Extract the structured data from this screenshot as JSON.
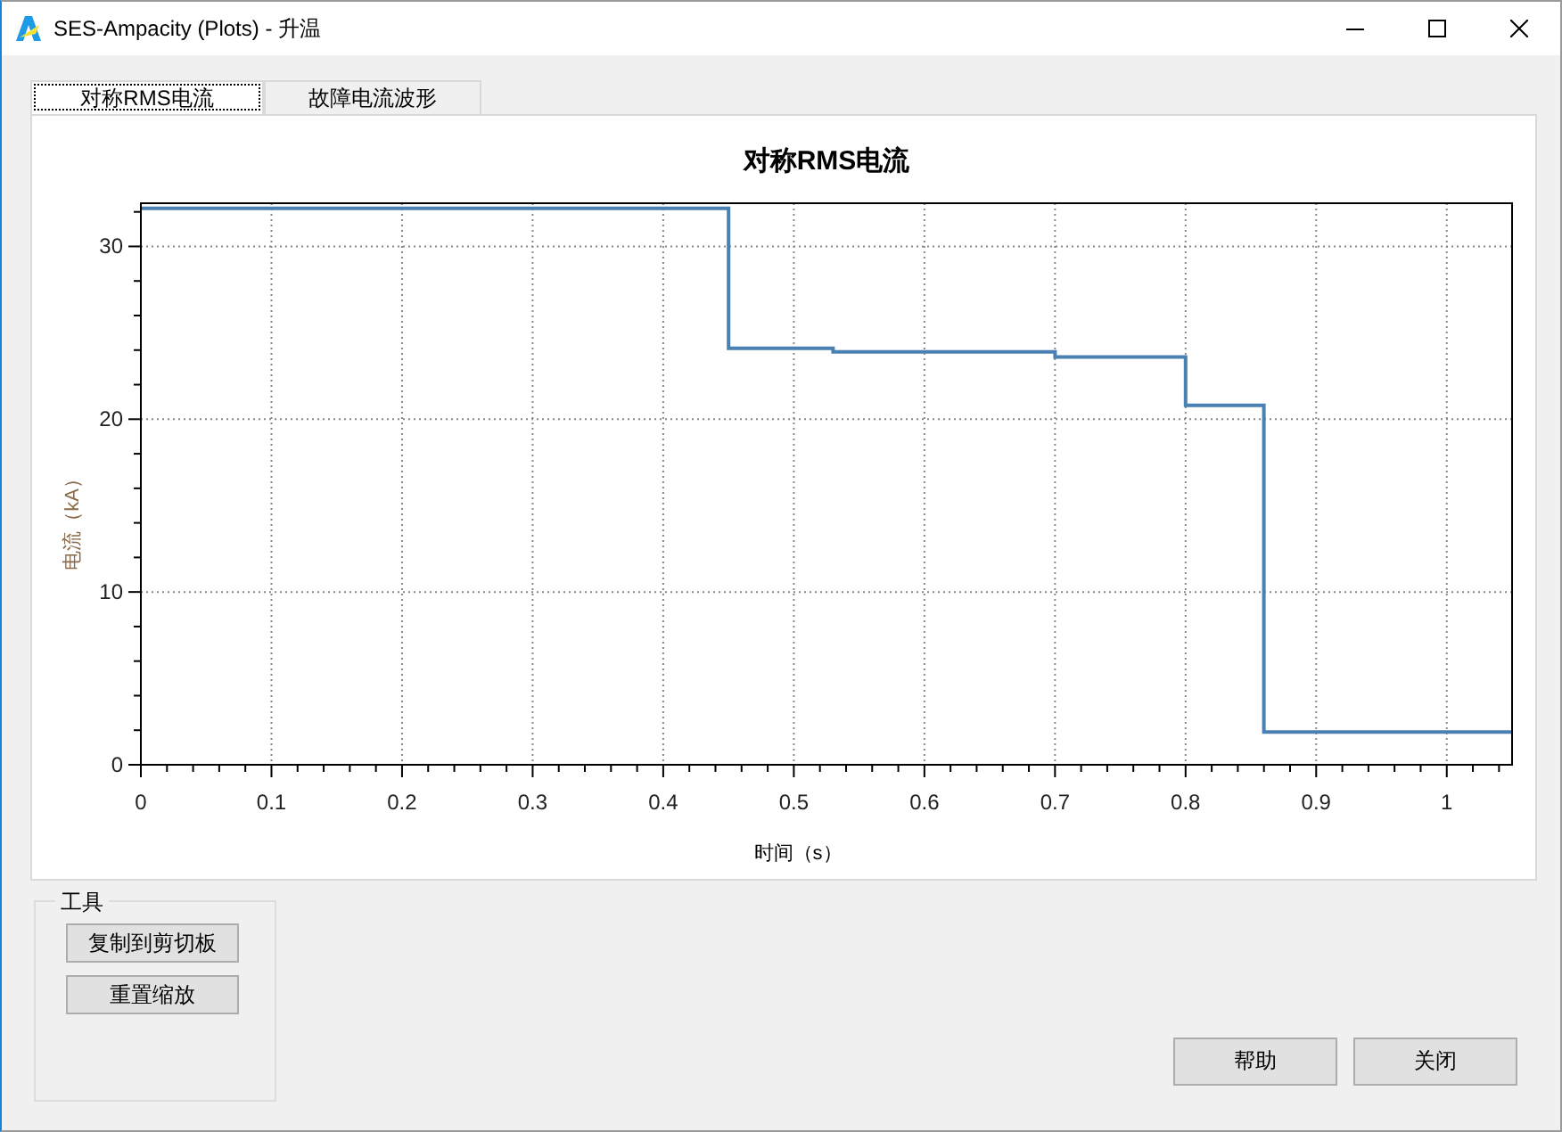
{
  "window": {
    "title": "SES-Ampacity (Plots) - 升温"
  },
  "tabs": [
    {
      "label": "对称RMS电流",
      "selected": true
    },
    {
      "label": "故障电流波形",
      "selected": false
    }
  ],
  "chart": {
    "chart_data": {
      "type": "line",
      "title": "对称RMS电流",
      "xlabel": "时间（s）",
      "ylabel": "电流（kA）",
      "x": [
        0,
        0.45,
        0.45,
        0.53,
        0.53,
        0.7,
        0.7,
        0.8,
        0.8,
        0.86,
        0.86,
        1.05
      ],
      "series": [
        {
          "color": "#4a80b2",
          "values": [
            32.2,
            32.2,
            24.1,
            24.1,
            23.9,
            23.9,
            23.6,
            23.6,
            20.8,
            20.8,
            1.9,
            1.9
          ]
        }
      ],
      "xlim": [
        0,
        1.05
      ],
      "ylim": [
        0,
        32.5
      ],
      "xticks": [
        0,
        0.1,
        0.2,
        0.3,
        0.4,
        0.5,
        0.6,
        0.7,
        0.8,
        0.9,
        1
      ],
      "yticks": [
        0,
        10,
        20,
        30
      ],
      "grid": true
    }
  },
  "tools_group": {
    "title": "工具",
    "buttons": [
      "复制到剪切板",
      "重置缩放"
    ]
  },
  "buttons": [
    "帮助",
    "关闭"
  ]
}
